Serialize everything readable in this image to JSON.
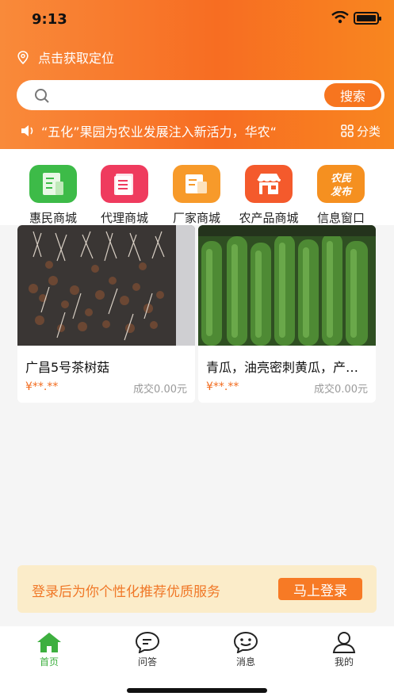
{
  "status_bar": {
    "time": "9:13"
  },
  "header": {
    "location_text": "点击获取定位",
    "search": {
      "placeholder": "",
      "button_label": "搜索"
    },
    "notice_text": "“五化”果园为农业发展注入新活力，华农“",
    "category_label": "分类"
  },
  "quick_entries": [
    {
      "label": "惠民商城",
      "color": "#3dbb48"
    },
    {
      "label": "代理商城",
      "color": "#ef3b5e"
    },
    {
      "label": "厂家商城",
      "color": "#f79a2a"
    },
    {
      "label": "农产品商城",
      "color": "#f45a2c"
    },
    {
      "label": "信息窗口",
      "color": "#f59020",
      "icon_text": "农民发布"
    }
  ],
  "products": [
    {
      "title": "广昌5号茶树菇",
      "price": "¥**.**",
      "deal": "成交0.00元"
    },
    {
      "title": "青瓜，油亮密刺黄瓜，产地直供",
      "price": "¥**.**",
      "deal": "成交0.00元"
    }
  ],
  "login_banner": {
    "text": "登录后为你个性化推荐优质服务",
    "button_label": "马上登录"
  },
  "tabbar": [
    {
      "label": "首页",
      "icon": "home-icon",
      "active": true
    },
    {
      "label": "问答",
      "icon": "qa-icon",
      "active": false
    },
    {
      "label": "消息",
      "icon": "message-icon",
      "active": false
    },
    {
      "label": "我的",
      "icon": "profile-icon",
      "active": false
    }
  ],
  "colors": {
    "brand_orange": "#f7751f",
    "active_green": "#3daf3f"
  }
}
